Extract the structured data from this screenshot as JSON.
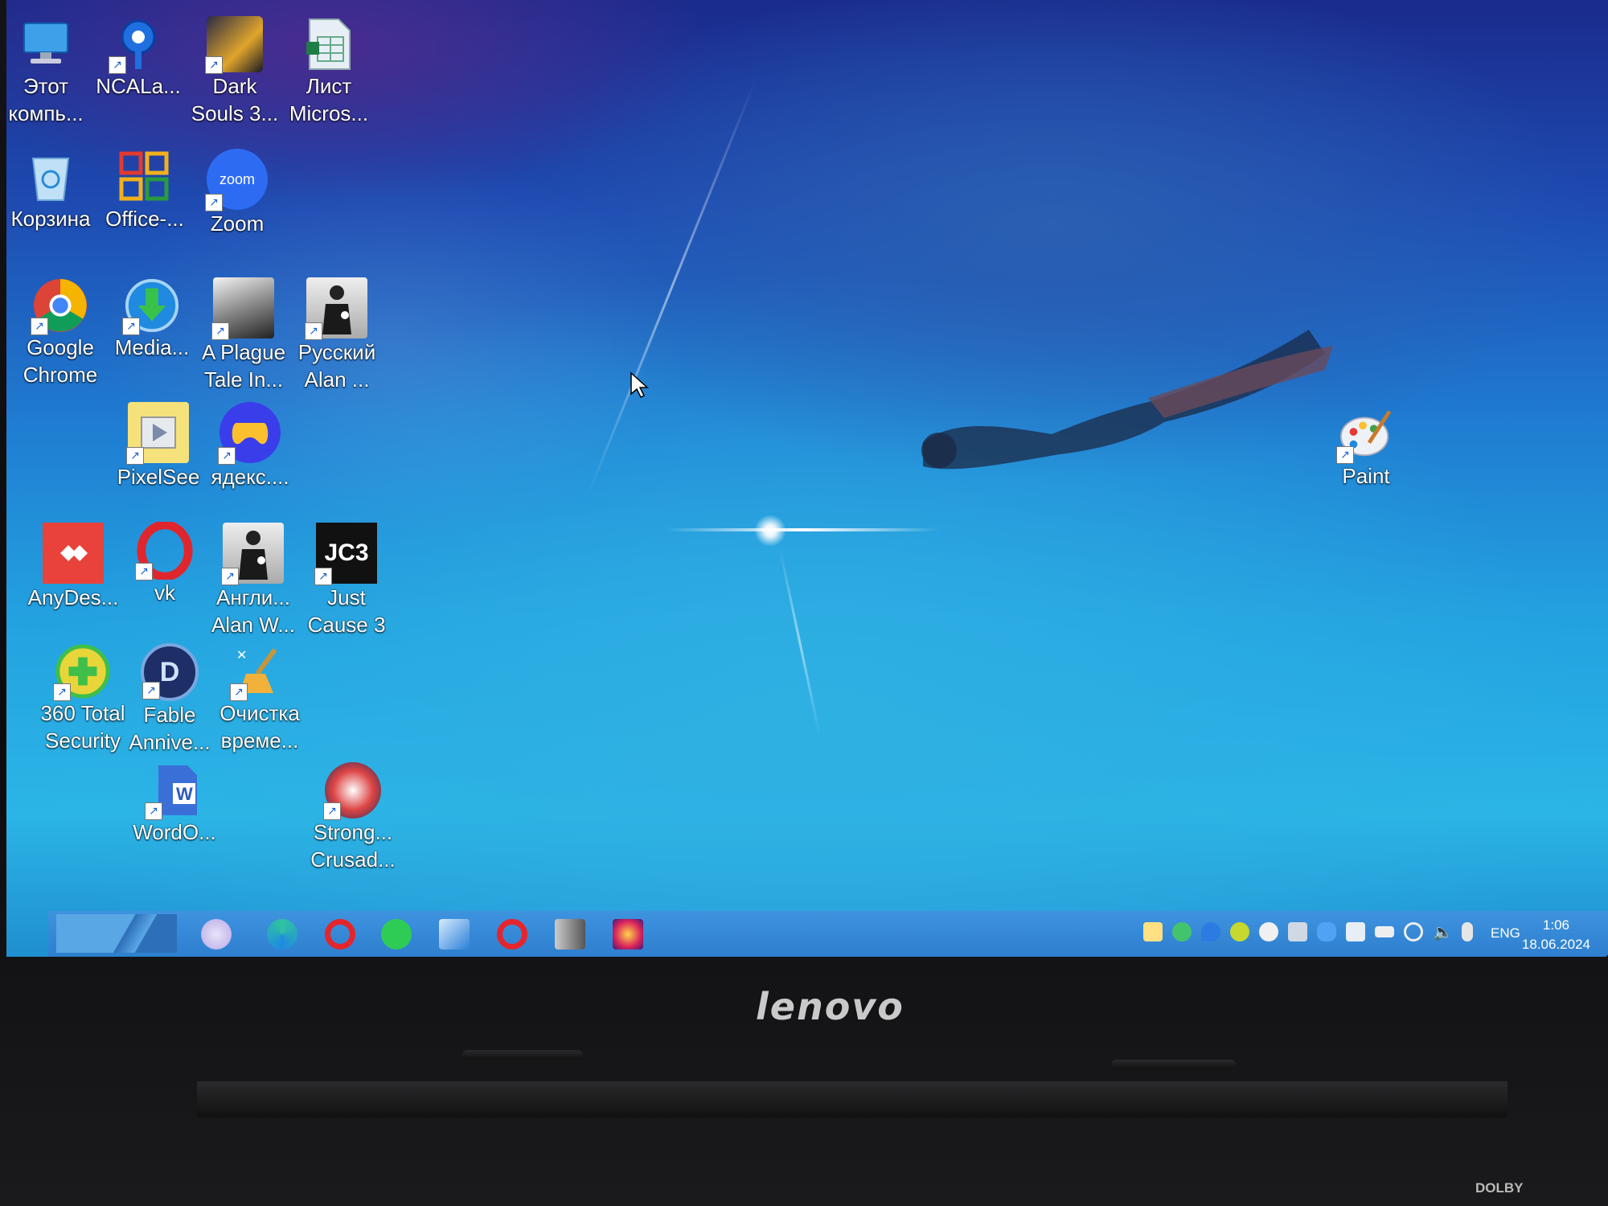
{
  "desktop": {
    "icons": [
      {
        "id": "this-pc",
        "line1": "Этот",
        "line2": "компь..."
      },
      {
        "id": "ncalayer",
        "line1": "NCALa...",
        "line2": ""
      },
      {
        "id": "dark-souls",
        "line1": "Dark",
        "line2": "Souls 3..."
      },
      {
        "id": "excel-sheet",
        "line1": "Лист",
        "line2": "Micros..."
      },
      {
        "id": "recycle-bin",
        "line1": "Корзина",
        "line2": ""
      },
      {
        "id": "office",
        "line1": "Office-...",
        "line2": ""
      },
      {
        "id": "zoom",
        "line1": "Zoom",
        "line2": ""
      },
      {
        "id": "chrome",
        "line1": "Google",
        "line2": "Chrome"
      },
      {
        "id": "media",
        "line1": "Media...",
        "line2": ""
      },
      {
        "id": "plague-tale",
        "line1": "A Plague",
        "line2": "Tale In..."
      },
      {
        "id": "alan-ru",
        "line1": "Русский",
        "line2": "Alan ..."
      },
      {
        "id": "pixelsee",
        "line1": "PixelSee",
        "line2": ""
      },
      {
        "id": "yandex-games",
        "line1": "ядекс....",
        "line2": ""
      },
      {
        "id": "anydesk",
        "line1": "AnyDes...",
        "line2": ""
      },
      {
        "id": "vk",
        "line1": "vk",
        "line2": ""
      },
      {
        "id": "alan-en",
        "line1": "Англи...",
        "line2": "Alan W..."
      },
      {
        "id": "just-cause",
        "line1": "Just",
        "line2": "Cause 3"
      },
      {
        "id": "360-security",
        "line1": "360 Total",
        "line2": "Security"
      },
      {
        "id": "fable",
        "line1": "Fable",
        "line2": "Annive..."
      },
      {
        "id": "cleanup",
        "line1": "Очистка",
        "line2": "време..."
      },
      {
        "id": "wordo",
        "line1": "WordO...",
        "line2": ""
      },
      {
        "id": "stronghold",
        "line1": "Strong...",
        "line2": "Crusad..."
      },
      {
        "id": "paint",
        "line1": "Paint",
        "line2": ""
      }
    ],
    "jc3_text": "JC3",
    "zoom_text": "zoom",
    "word_letter": "W",
    "fable_letter": "D"
  },
  "taskbar": {
    "language": "ENG",
    "time": "1:06",
    "date": "18.06.2024",
    "pinned": [
      "app-circle",
      "edge",
      "opera",
      "whatsapp",
      "tools",
      "opera-gx",
      "typora",
      "burst"
    ]
  },
  "hardware": {
    "brand": "lenovo",
    "dolby": "DOLBY"
  }
}
